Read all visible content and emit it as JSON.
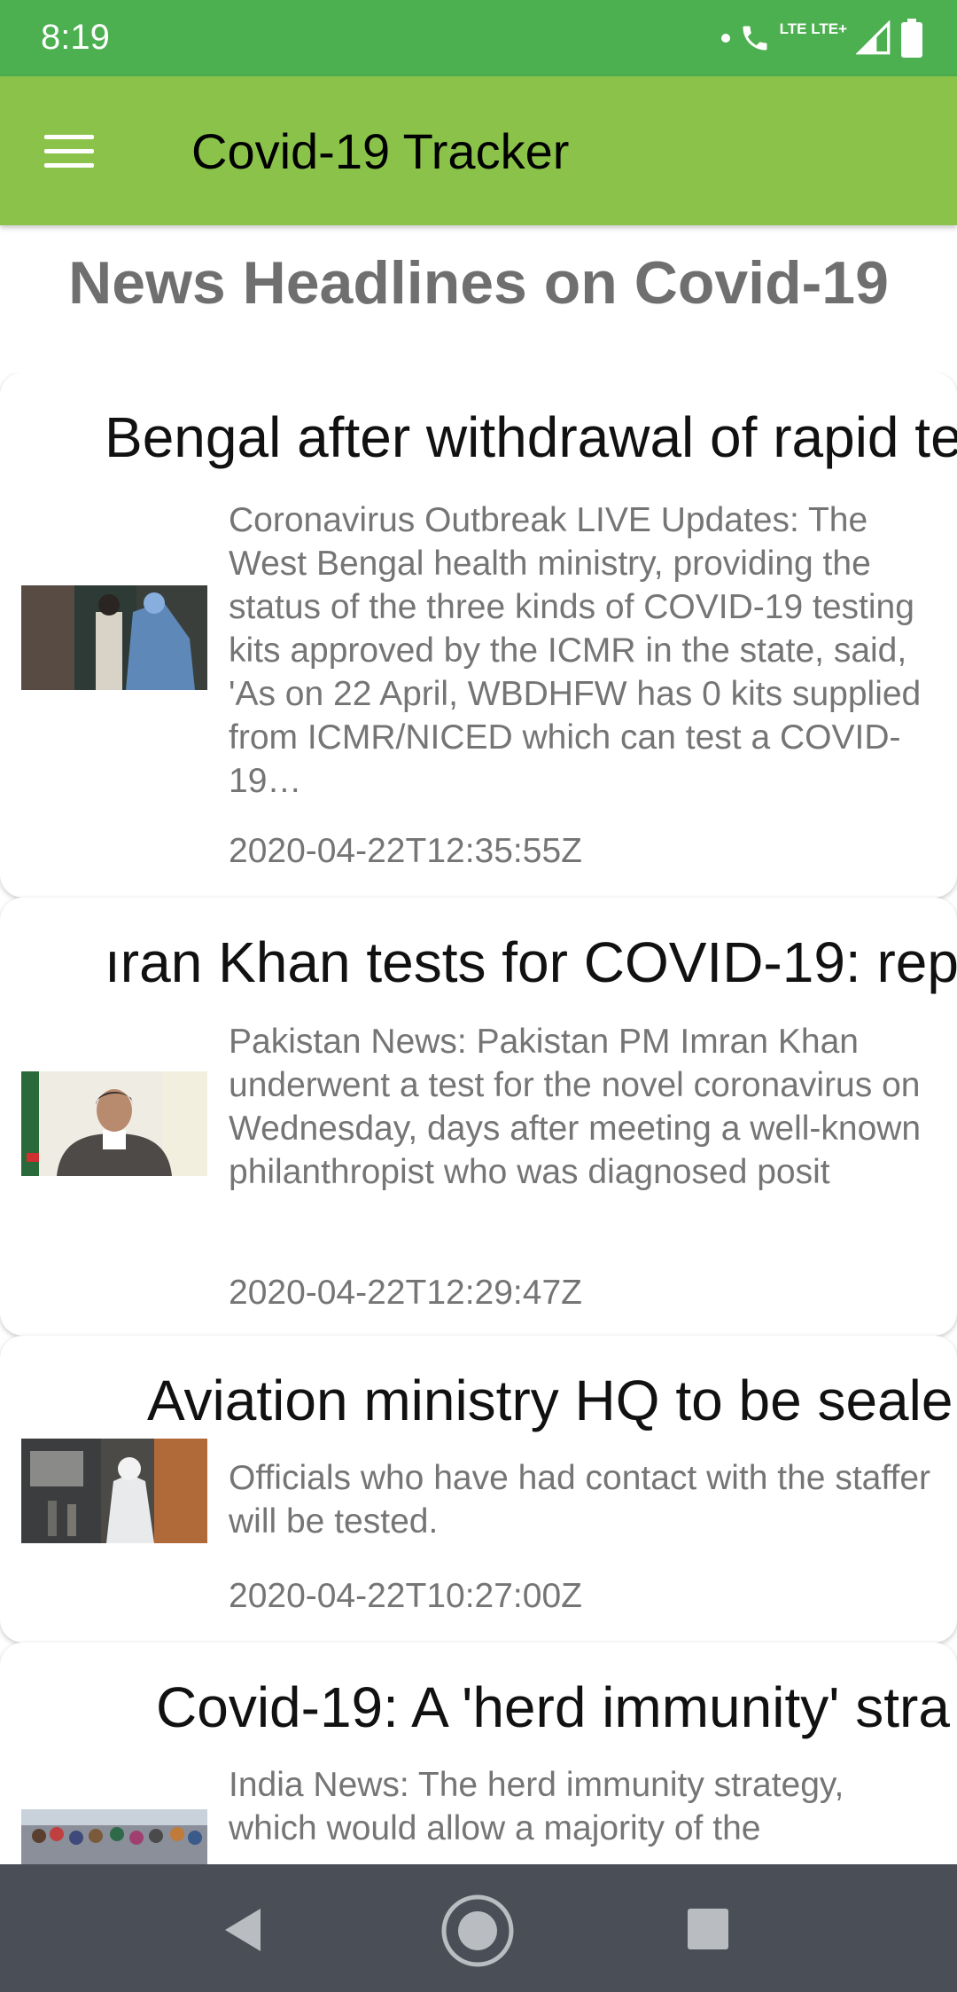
{
  "status_bar": {
    "time": "8:19",
    "network": "LTE LTE+"
  },
  "app_bar": {
    "title": "Covid-19 Tracker",
    "menu_icon": "hamburger-menu-icon"
  },
  "page_heading": "News Headlines on Covid-19",
  "articles": [
    {
      "title": "Bengal after withdrawal of rapid te",
      "description": "Coronavirus Outbreak LIVE Updates: The West Bengal health ministry, providing the status of the three kinds of COVID-19 testing kits approved by the ICMR in the state, said, 'As on 22 April, WBDHFW has 0 kits supplied from ICMR/NICED which can test a COVID-19…",
      "published_at": "2020-04-22T12:35:55Z"
    },
    {
      "title": "ıran Khan tests for COVID-19: repo",
      "description": "Pakistan News: Pakistan PM Imran Khan underwent a test for the novel coronavirus on Wednesday, days after meeting a well-known philanthropist who was diagnosed posit",
      "published_at": "2020-04-22T12:29:47Z"
    },
    {
      "title": "Aviation ministry HQ to be seale",
      "description": "Officials who have had contact with the staffer will be tested.",
      "published_at": "2020-04-22T10:27:00Z"
    },
    {
      "title": "Covid-19: A 'herd immunity' stra",
      "description": "India News: The herd immunity strategy, which would allow a majority of the",
      "published_at": ""
    }
  ],
  "nav_bar": {
    "back_icon": "back-triangle-icon",
    "home_icon": "home-circle-icon",
    "recents_icon": "recents-square-icon"
  }
}
